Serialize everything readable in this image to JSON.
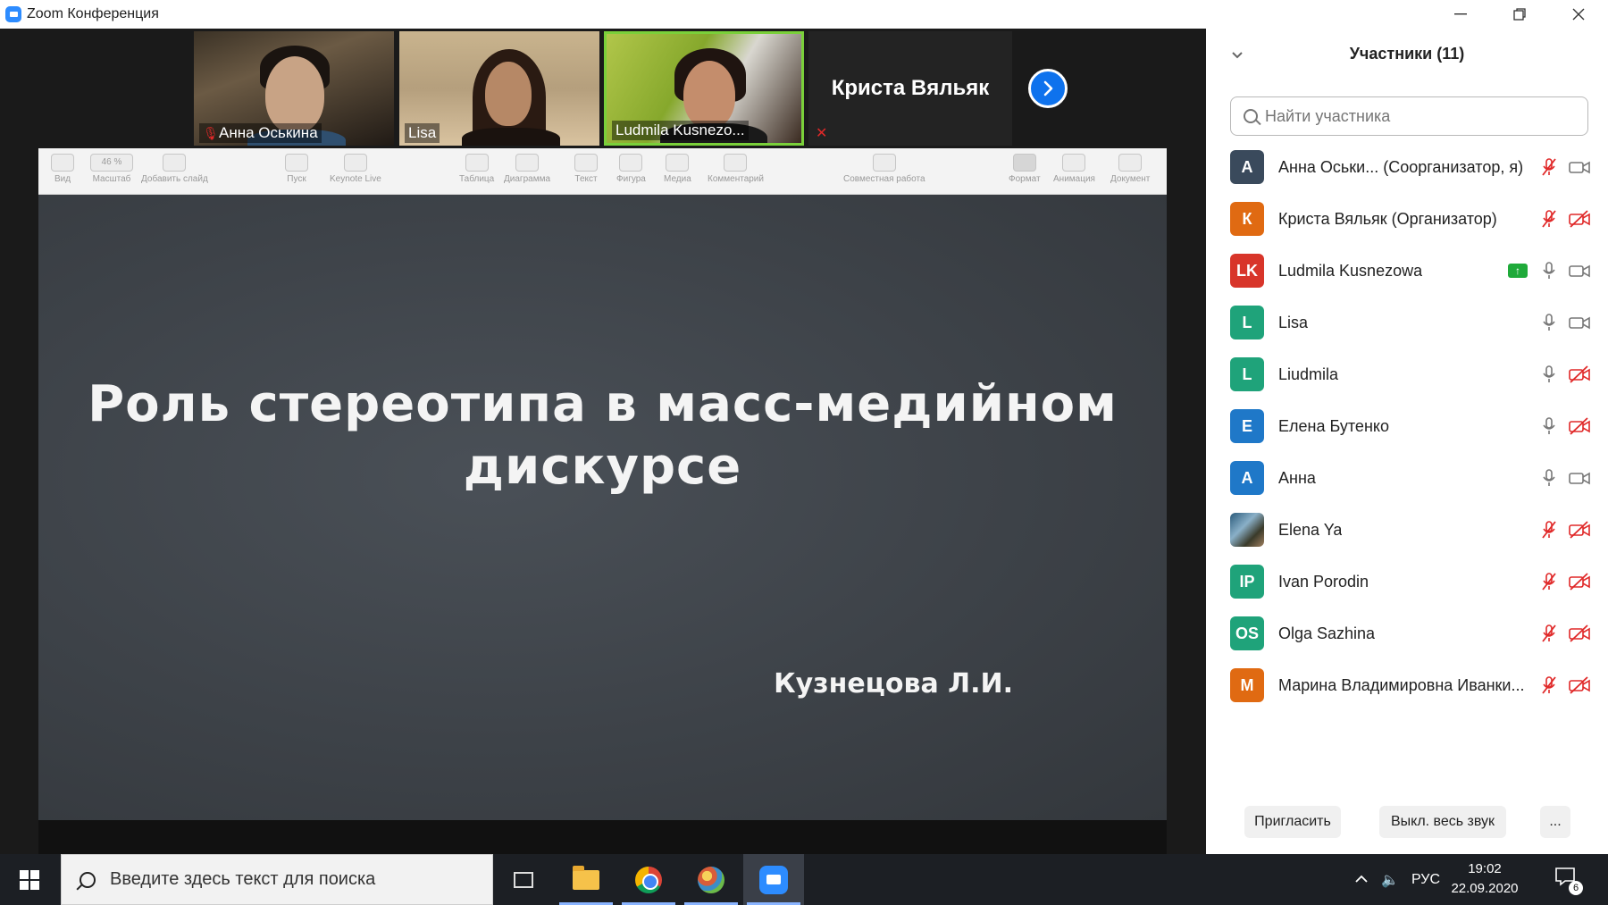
{
  "window": {
    "title": "Zoom Конференция"
  },
  "thumbnails": [
    {
      "name": "Анна Оськина",
      "muted": true
    },
    {
      "name": "Lisa",
      "muted": false
    },
    {
      "name": "Ludmila Kusnezo...",
      "muted": false,
      "active_speaker": true
    }
  ],
  "featured_name": "Криста Вяльяк",
  "keynote_toolbar": [
    "Вид",
    "Масштаб",
    "Добавить слайд",
    "Пуск",
    "Keynote Live",
    "Таблица",
    "Диаграмма",
    "Текст",
    "Фигура",
    "Медиа",
    "Комментарий",
    "Совместная работа",
    "Формат",
    "Анимация",
    "Документ"
  ],
  "keynote_zoom": "46 %",
  "slide": {
    "title_line1": "Роль стереотипа в масс-медийном",
    "title_line2": "дискурсе",
    "author": "Кузнецова Л.И."
  },
  "panel": {
    "title": "Участники (11)",
    "search_placeholder": "Найти участника",
    "participants": [
      {
        "initials": "А",
        "color": "#3a4a5c",
        "name": "Анна Оськи...  (Соорганизатор, я)",
        "mic": "off",
        "cam": "on"
      },
      {
        "initials": "К",
        "color": "#e06a12",
        "name": "Криста Вяльяк (Организатор)",
        "mic": "off",
        "cam": "off"
      },
      {
        "initials": "LK",
        "color": "#d8352a",
        "name": "Ludmila Kusnezowa",
        "mic": "on",
        "cam": "on",
        "sharing": true
      },
      {
        "initials": "L",
        "color": "#1fa37a",
        "name": "Lisa",
        "mic": "on",
        "cam": "on"
      },
      {
        "initials": "L",
        "color": "#1fa37a",
        "name": "Liudmila",
        "mic": "on",
        "cam": "off"
      },
      {
        "initials": "Е",
        "color": "#1f78c8",
        "name": "Елена Бутенко",
        "mic": "on",
        "cam": "off"
      },
      {
        "initials": "А",
        "color": "#1f78c8",
        "name": "Анна",
        "mic": "on",
        "cam": "on"
      },
      {
        "initials": "",
        "color": "#3a6a8a",
        "name": "Elena Ya",
        "mic": "off",
        "cam": "off",
        "photo": true
      },
      {
        "initials": "IP",
        "color": "#1fa37a",
        "name": "Ivan Porodin",
        "mic": "off",
        "cam": "off"
      },
      {
        "initials": "OS",
        "color": "#1fa37a",
        "name": "Olga Sazhina",
        "mic": "off",
        "cam": "off"
      },
      {
        "initials": "М",
        "color": "#e06a12",
        "name": "Марина Владимировна Иванки...",
        "mic": "off",
        "cam": "off"
      }
    ],
    "invite_label": "Пригласить",
    "mute_all_label": "Выкл. весь звук",
    "more_label": "..."
  },
  "taskbar": {
    "search_placeholder": "Введите здесь текст для поиска",
    "language": "РУС",
    "time": "19:02",
    "date": "22.09.2020",
    "notifications": "6"
  }
}
